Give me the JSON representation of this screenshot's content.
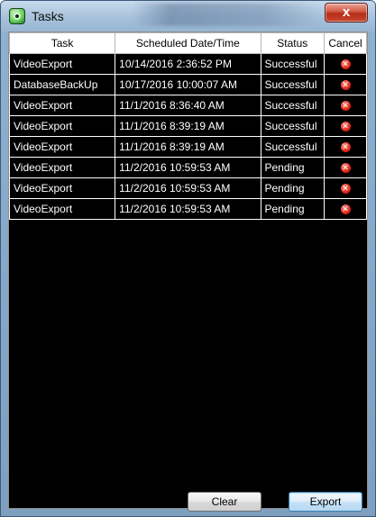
{
  "window": {
    "title": "Tasks",
    "close_label": "x"
  },
  "table": {
    "headers": [
      "Task",
      "Scheduled Date/Time",
      "Status",
      "Cancel"
    ],
    "rows": [
      {
        "task": "VideoExport",
        "datetime": "10/14/2016 2:36:52 PM",
        "status": "Successful"
      },
      {
        "task": "DatabaseBackUp",
        "datetime": "10/17/2016 10:00:07 AM",
        "status": "Successful"
      },
      {
        "task": "VideoExport",
        "datetime": "11/1/2016 8:36:40 AM",
        "status": "Successful"
      },
      {
        "task": "VideoExport",
        "datetime": "11/1/2016 8:39:19 AM",
        "status": "Successful"
      },
      {
        "task": "VideoExport",
        "datetime": "11/1/2016 8:39:19 AM",
        "status": "Successful"
      },
      {
        "task": "VideoExport",
        "datetime": "11/2/2016 10:59:53 AM",
        "status": "Pending"
      },
      {
        "task": "VideoExport",
        "datetime": "11/2/2016 10:59:53 AM",
        "status": "Pending"
      },
      {
        "task": "VideoExport",
        "datetime": "11/2/2016 10:59:53 AM",
        "status": "Pending"
      }
    ],
    "cancel_icon": "cancel-x-icon"
  },
  "buttons": {
    "clear": "Clear",
    "export": "Export"
  },
  "colors": {
    "grid_background": "#000000",
    "cell_text": "#ffffff",
    "cancel_icon": "#e2281a"
  }
}
